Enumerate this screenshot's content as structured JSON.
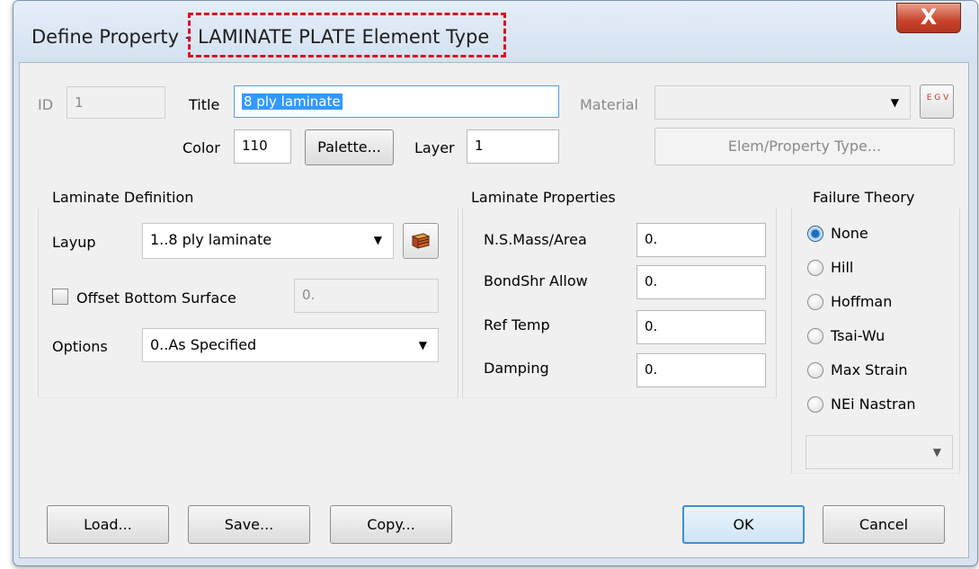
{
  "window": {
    "title_prefix": "Define Property - ",
    "title_highlight": "LAMINATE PLATE Element Type",
    "close_glyph": "X"
  },
  "header": {
    "id_label": "ID",
    "id_value": "1",
    "title_label": "Title",
    "title_value": "8 ply laminate",
    "material_label": "Material",
    "material_value": "",
    "color_label": "Color",
    "color_value": "110",
    "palette_button": "Palette...",
    "layer_label": "Layer",
    "layer_value": "1",
    "elem_type_button": "Elem/Property Type...",
    "material_icon_text": "E G V"
  },
  "laminate_definition": {
    "heading": "Laminate Definition",
    "layup_label": "Layup",
    "layup_value": "1..8 ply laminate",
    "offset_label": "Offset Bottom Surface",
    "offset_checked": false,
    "offset_value": "0.",
    "options_label": "Options",
    "options_value": "0..As Specified"
  },
  "laminate_properties": {
    "heading": "Laminate Properties",
    "rows": [
      {
        "label": "N.S.Mass/Area",
        "value": "0."
      },
      {
        "label": "BondShr Allow",
        "value": "0."
      },
      {
        "label": "Ref Temp",
        "value": "0."
      },
      {
        "label": "Damping",
        "value": "0."
      }
    ]
  },
  "failure_theory": {
    "heading": "Failure Theory",
    "options": [
      "None",
      "Hill",
      "Hoffman",
      "Tsai-Wu",
      "Max Strain",
      "NEi Nastran"
    ],
    "selected": "None",
    "dropdown_value": ""
  },
  "footer": {
    "load": "Load...",
    "save": "Save...",
    "copy": "Copy...",
    "ok": "OK",
    "cancel": "Cancel"
  },
  "colors": {
    "highlight_border": "#d8121e",
    "selection": "#3399ff",
    "close_button": "#c8432a"
  },
  "icons": {
    "close": "close-icon",
    "material": "material-library-icon",
    "layup": "layup-editor-icon",
    "dropdown": "chevron-down-icon"
  }
}
